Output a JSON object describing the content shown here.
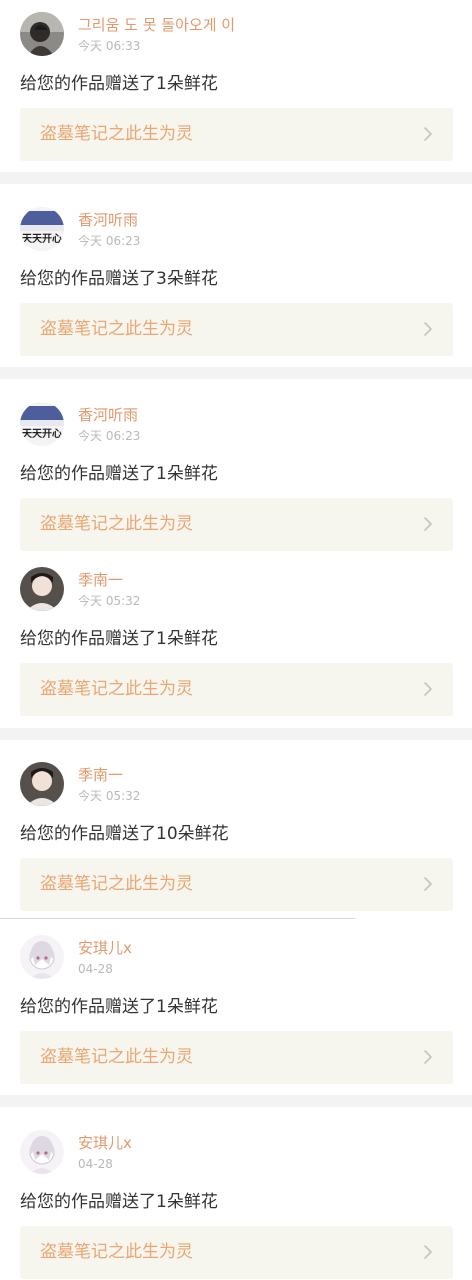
{
  "items": [
    {
      "user": "그리움 도 못 돌아오게 이",
      "time": "今天 06:33",
      "message": "给您的作品赠送了1朵鲜花",
      "work_title": "盗墓笔记之此生为灵",
      "avatar": "dark-portrait"
    },
    {
      "user": "香河听雨",
      "time": "今天 06:23",
      "message": "给您的作品赠送了3朵鲜花",
      "work_title": "盗墓笔记之此生为灵",
      "avatar": "text-banner",
      "avatar_text": "天天开心"
    },
    {
      "user": "香河听雨",
      "time": "今天 06:23",
      "message": "给您的作品赠送了1朵鲜花",
      "work_title": "盗墓笔记之此生为灵",
      "avatar": "text-banner",
      "avatar_text": "天天开心"
    },
    {
      "user": "季南一",
      "time": "今天 05:32",
      "message": "给您的作品赠送了1朵鲜花",
      "work_title": "盗墓笔记之此生为灵",
      "avatar": "boy-portrait"
    },
    {
      "user": "季南一",
      "time": "今天 05:32",
      "message": "给您的作品赠送了10朵鲜花",
      "work_title": "盗墓笔记之此生为灵",
      "avatar": "boy-portrait"
    },
    {
      "user": "安琪儿x",
      "time": "04-28",
      "message": "给您的作品赠送了1朵鲜花",
      "work_title": "盗墓笔记之此生为灵",
      "avatar": "anime-girl"
    },
    {
      "user": "安琪儿x",
      "time": "04-28",
      "message": "给您的作品赠送了1朵鲜花",
      "work_title": "盗墓笔记之此生为灵",
      "avatar": "anime-girl"
    }
  ],
  "colors": {
    "username": "#e29a6c",
    "work_title": "#eba672",
    "work_card_bg": "#f6f5ee",
    "separator": "#f3f3f3",
    "time": "#b9b9b9",
    "message": "#333333"
  }
}
